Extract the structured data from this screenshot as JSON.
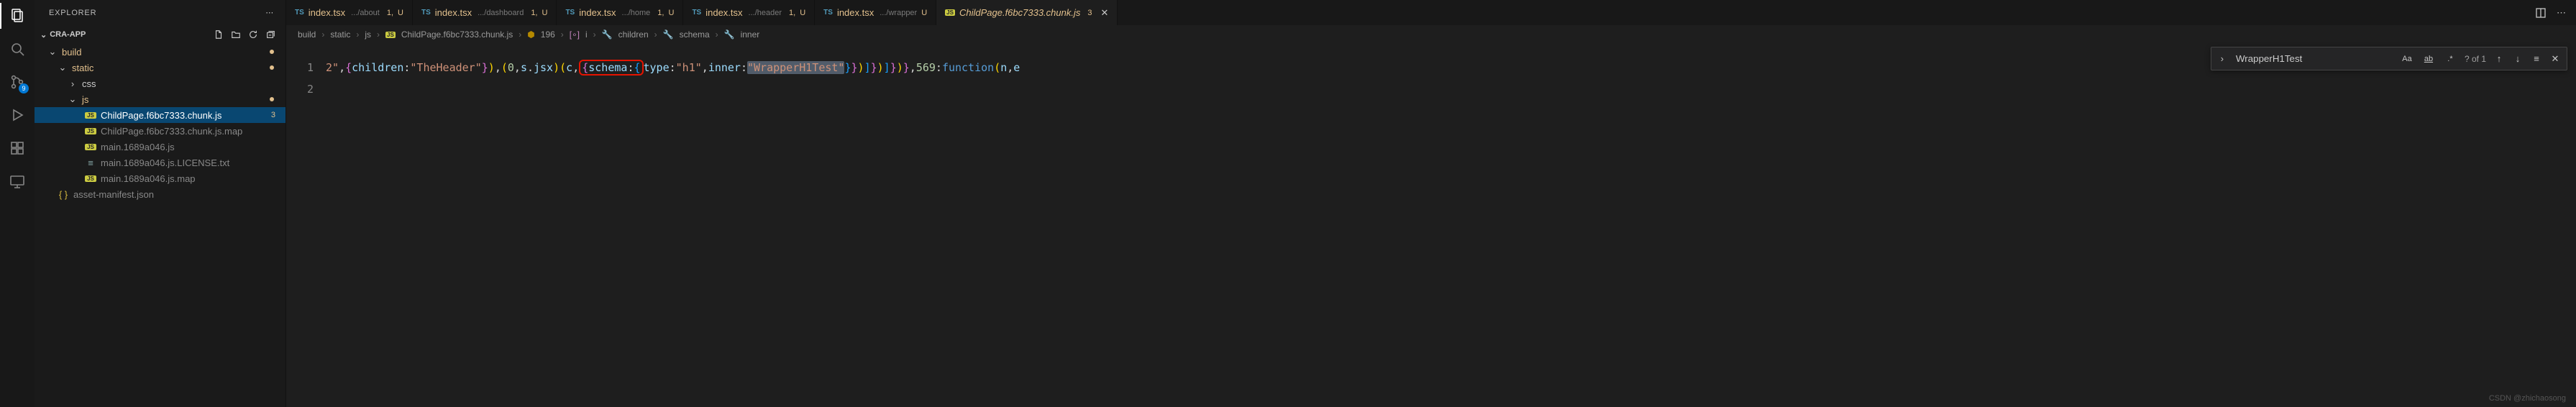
{
  "sidebar": {
    "title": "EXPLORER",
    "project": "CRA-APP",
    "tree": {
      "build": "build",
      "static": "static",
      "css": "css",
      "js": "js",
      "f1": "ChildPage.f6bc7333.chunk.js",
      "f1_badge": "3",
      "f2": "ChildPage.f6bc7333.chunk.js.map",
      "f3": "main.1689a046.js",
      "f4": "main.1689a046.js.LICENSE.txt",
      "f5": "main.1689a046.js.map",
      "f6": "asset-manifest.json"
    }
  },
  "activity": {
    "scm_badge": "9"
  },
  "tabs": [
    {
      "ts": "TS",
      "name": "index.tsx",
      "path": ".../about",
      "m": "1,",
      "u": "U"
    },
    {
      "ts": "TS",
      "name": "index.tsx",
      "path": ".../dashboard",
      "m": "1,",
      "u": "U"
    },
    {
      "ts": "TS",
      "name": "index.tsx",
      "path": ".../home",
      "m": "1,",
      "u": "U"
    },
    {
      "ts": "TS",
      "name": "index.tsx",
      "path": ".../header",
      "m": "1,",
      "u": "U"
    },
    {
      "ts": "TS",
      "name": "index.tsx",
      "path": ".../wrapper",
      "m": "",
      "u": "U"
    }
  ],
  "active_tab": {
    "name": "ChildPage.f6bc7333.chunk.js",
    "m": "3"
  },
  "breadcrumbs": {
    "b1": "build",
    "b2": "static",
    "b3": "js",
    "b4": "ChildPage.f6bc7333.chunk.js",
    "b5": "196",
    "b6": "i",
    "b7": "children",
    "b8": "schema",
    "b9": "inner"
  },
  "editor": {
    "ln1": "1",
    "ln2": "2",
    "seg1": "2\"",
    "seg_children": "children",
    "seg_theheader": "\"TheHeader\"",
    "seg_jsx": "s",
    "seg_jsx2": "jsx",
    "seg_c": "c",
    "seg_schema": "schema",
    "seg_type": "type",
    "seg_h1": "\"h1\"",
    "seg_inner": "inner",
    "seg_wrapper": "\"WrapperH1Test\"",
    "seg_569": "569",
    "seg_function": "function",
    "seg_ne": "n",
    "seg_e": "e"
  },
  "find": {
    "value": "WrapperH1Test",
    "opt_aa": "Aa",
    "opt_ab": "ab",
    "opt_re": ".*",
    "count": "? of 1"
  },
  "watermark": "CSDN @zhichaosong"
}
